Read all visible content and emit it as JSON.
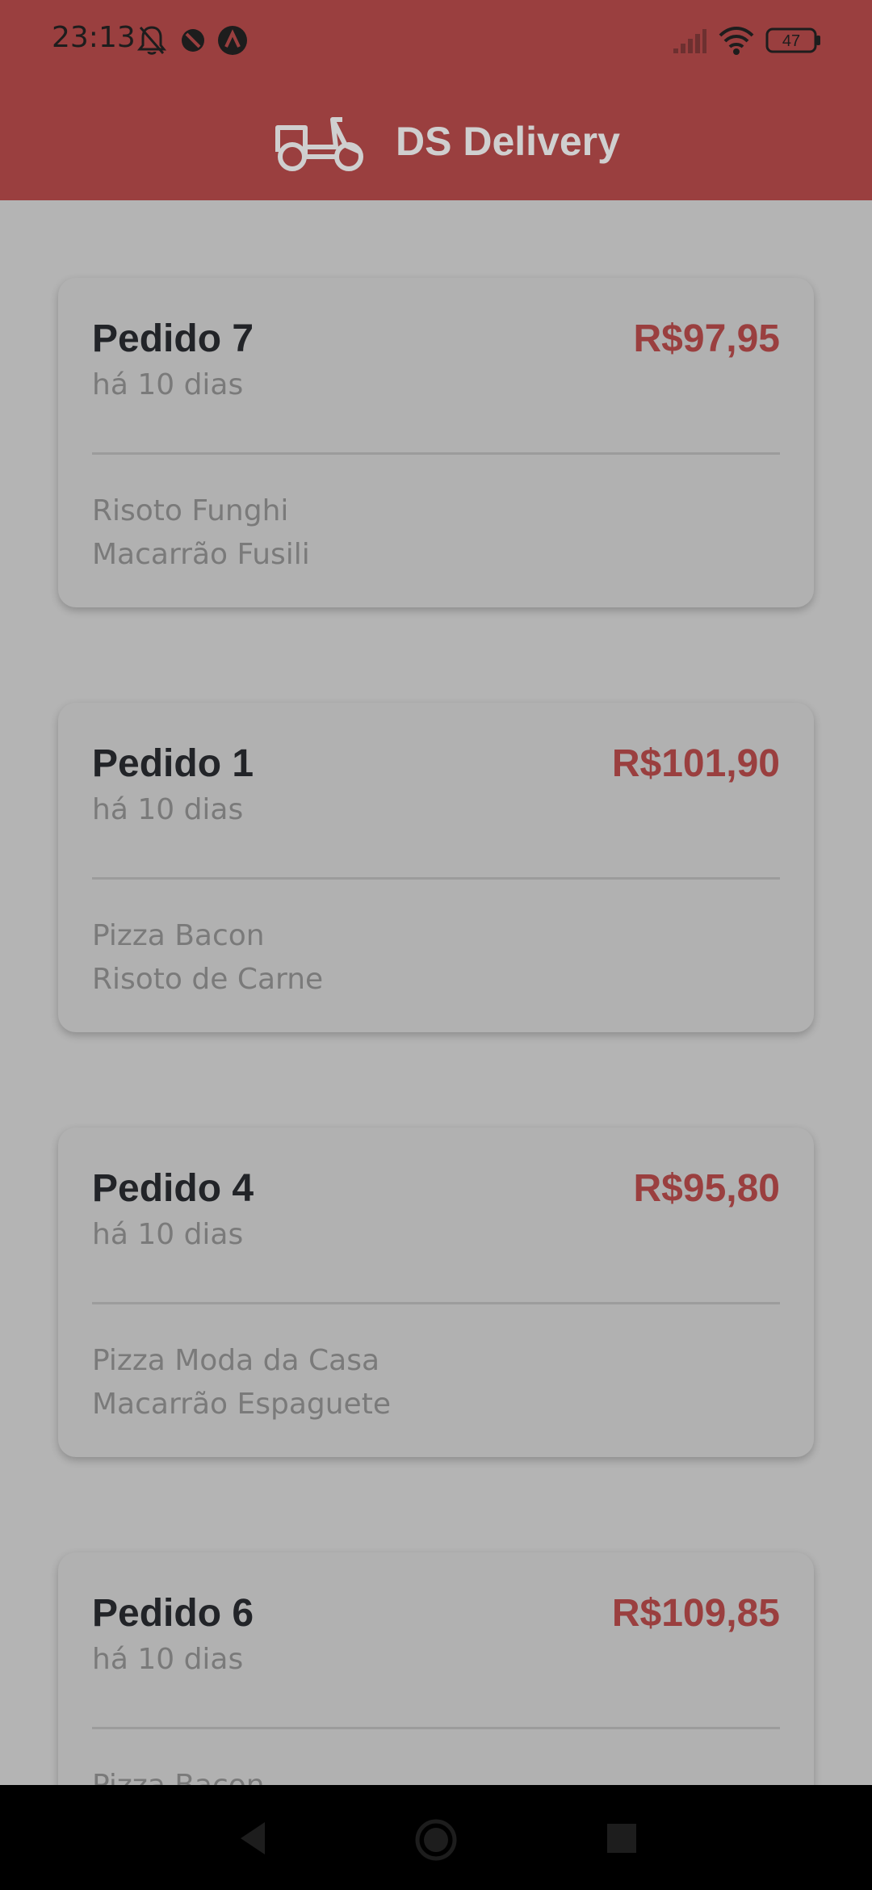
{
  "status_bar": {
    "time": "23:13",
    "battery": "47"
  },
  "header": {
    "title": "DS Delivery",
    "icon": "scooter-icon"
  },
  "orders": [
    {
      "name": "Pedido 7",
      "price": "R$97,95",
      "date": "há 10 dias",
      "items": [
        "Risoto Funghi",
        "Macarrão Fusili"
      ]
    },
    {
      "name": "Pedido 1",
      "price": "R$101,90",
      "date": "há 10 dias",
      "items": [
        "Pizza Bacon",
        "Risoto de Carne"
      ]
    },
    {
      "name": "Pedido 4",
      "price": "R$95,80",
      "date": "há 10 dias",
      "items": [
        "Pizza Moda da Casa",
        "Macarrão Espaguete"
      ]
    },
    {
      "name": "Pedido 6",
      "price": "R$109,85",
      "date": "há 10 dias",
      "items": [
        "Pizza Bacon"
      ]
    }
  ],
  "colors": {
    "brand": "#9a3f3f",
    "background": "#b4b4b4",
    "card": "#b1b1b1"
  }
}
